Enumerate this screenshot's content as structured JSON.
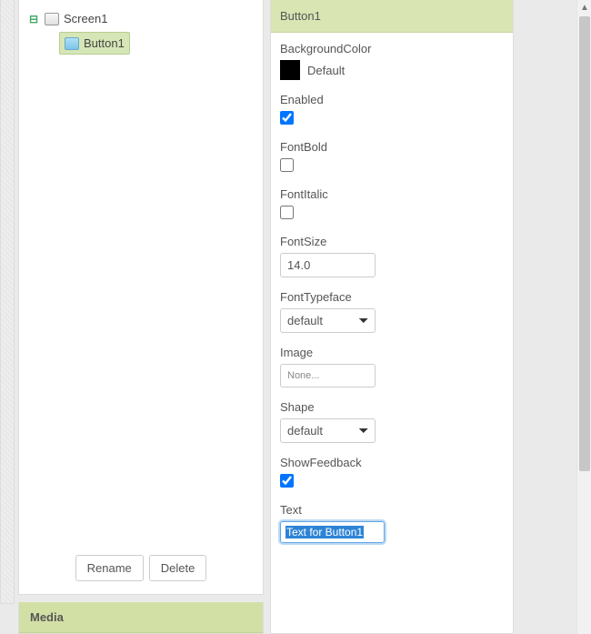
{
  "components": {
    "tree": [
      {
        "label": "Screen1",
        "expanded": true,
        "icon": "screen"
      },
      {
        "label": "Button1",
        "selected": true,
        "icon": "button"
      }
    ],
    "rename_label": "Rename",
    "delete_label": "Delete"
  },
  "media": {
    "header": "Media"
  },
  "properties": {
    "selected_component": "Button1",
    "items": {
      "backgroundcolor_label": "BackgroundColor",
      "backgroundcolor_value": "Default",
      "backgroundcolor_swatch": "#000000",
      "enabled_label": "Enabled",
      "enabled_value": true,
      "fontbold_label": "FontBold",
      "fontbold_value": false,
      "fontitalic_label": "FontItalic",
      "fontitalic_value": false,
      "fontsize_label": "FontSize",
      "fontsize_value": "14.0",
      "fonttypeface_label": "FontTypeface",
      "fonttypeface_value": "default",
      "image_label": "Image",
      "image_value": "None...",
      "shape_label": "Shape",
      "shape_value": "default",
      "showfeedback_label": "ShowFeedback",
      "showfeedback_value": true,
      "text_label": "Text",
      "text_value": "Text for Button1"
    }
  }
}
